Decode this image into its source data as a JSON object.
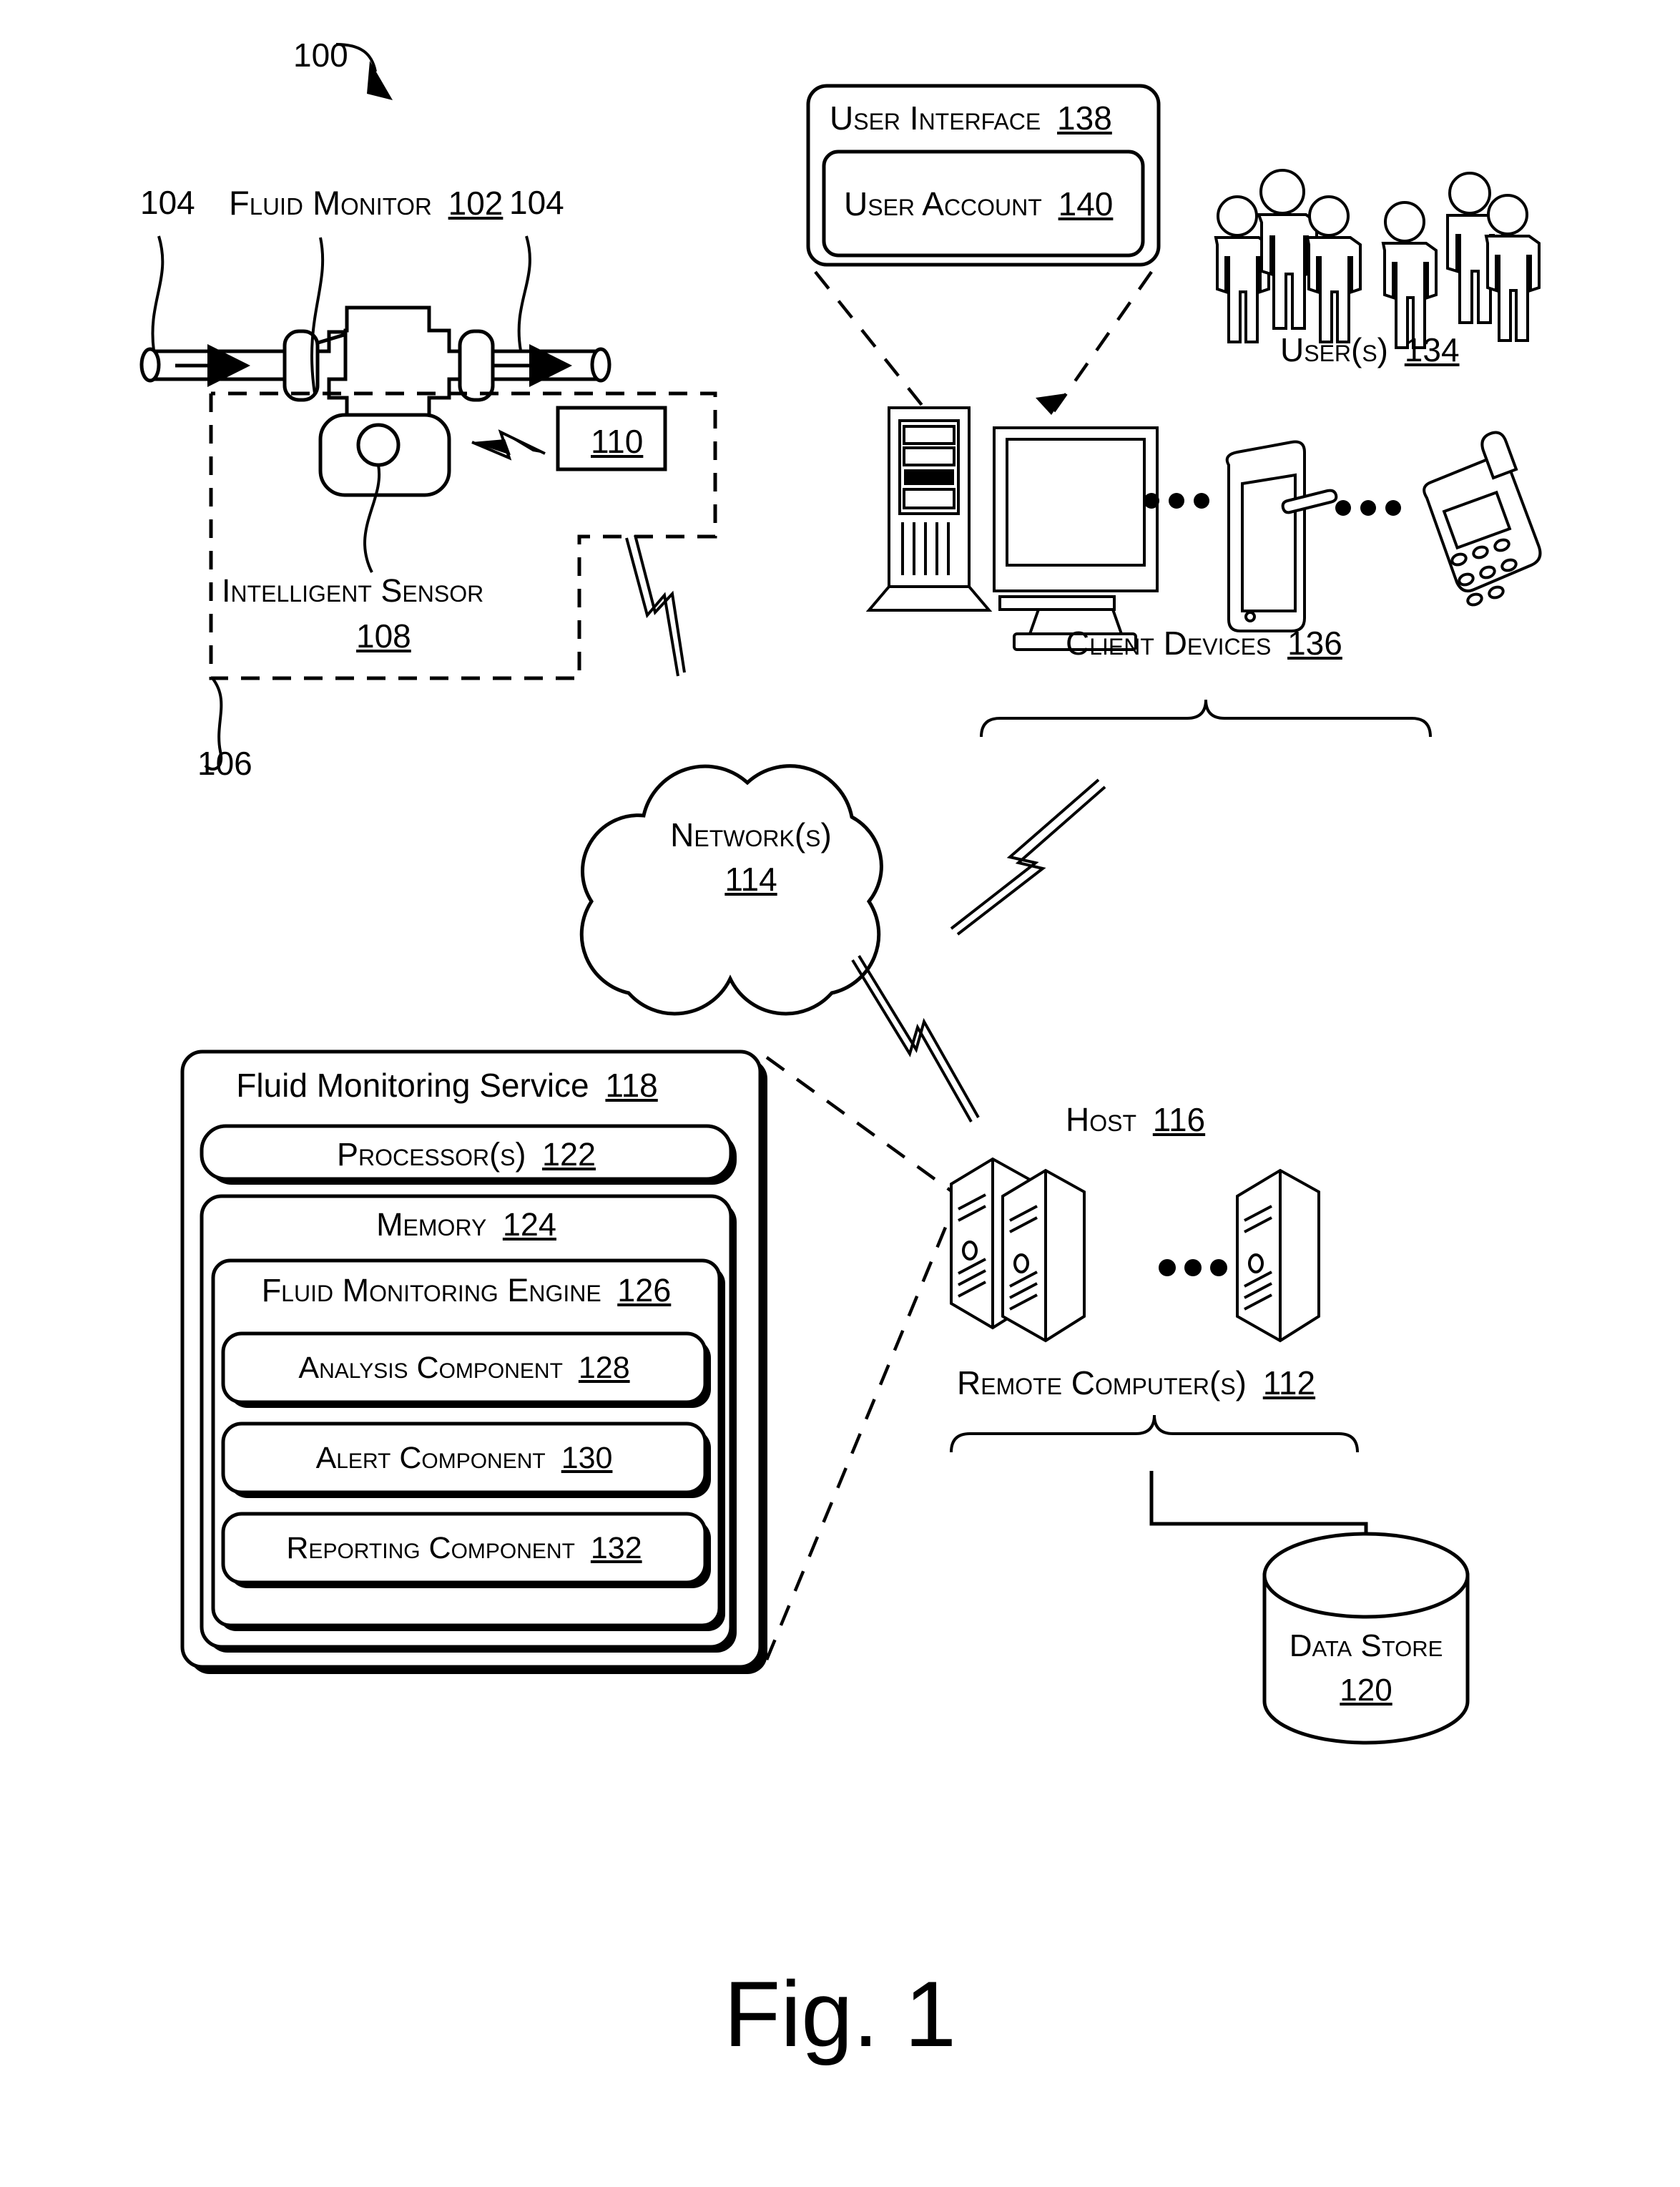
{
  "figure": {
    "caption": "Fig. 1",
    "system_ref": "100"
  },
  "fluid_monitor": {
    "title_text": "Fluid Monitor",
    "title_ref": "102",
    "pipe_left_ref": "104",
    "pipe_right_ref": "104",
    "flow_arrow_icon": "arrow-right-icon",
    "intelligent_sensor_label": "Intelligent Sensor",
    "intelligent_sensor_ref": "108",
    "transmitter_ref": "110",
    "assembly_ref": "106",
    "wireless_icon": "lightning-bolt-icon"
  },
  "user_interface": {
    "title_text": "User Interface",
    "title_ref": "138",
    "account_text": "User Account",
    "account_ref": "140"
  },
  "users": {
    "label_text": "User(s)",
    "label_ref": "134",
    "person_icon": "person-icon",
    "count_shown": 6
  },
  "client_devices": {
    "label_text": "Client Devices",
    "label_ref": "136",
    "devices": [
      {
        "name": "desktop-tower-icon"
      },
      {
        "name": "crt-monitor-icon"
      },
      {
        "name": "tablet-icon"
      },
      {
        "name": "mobile-phone-icon"
      }
    ],
    "ellipsis": "• • •"
  },
  "network": {
    "label_text": "Network(s)",
    "label_ref": "114",
    "shape": "cloud-icon"
  },
  "service": {
    "title_text": "Fluid Monitoring Service",
    "title_ref": "118",
    "processor_text": "Processor(s)",
    "processor_ref": "122",
    "memory_text": "Memory",
    "memory_ref": "124",
    "engine_text": "Fluid Monitoring Engine",
    "engine_ref": "126",
    "components": [
      {
        "text": "Analysis Component",
        "ref": "128"
      },
      {
        "text": "Alert Component",
        "ref": "130"
      },
      {
        "text": "Reporting Component",
        "ref": "132"
      }
    ]
  },
  "host": {
    "label_text": "Host",
    "label_ref": "116",
    "remote_text": "Remote Computer(s)",
    "remote_ref": "112",
    "server_icon": "server-tower-icon",
    "ellipsis": "• • •"
  },
  "data_store": {
    "label_text": "Data Store",
    "label_ref": "120",
    "shape": "cylinder-database-icon"
  },
  "colors": {
    "ink": "#000000",
    "paper": "#ffffff"
  }
}
